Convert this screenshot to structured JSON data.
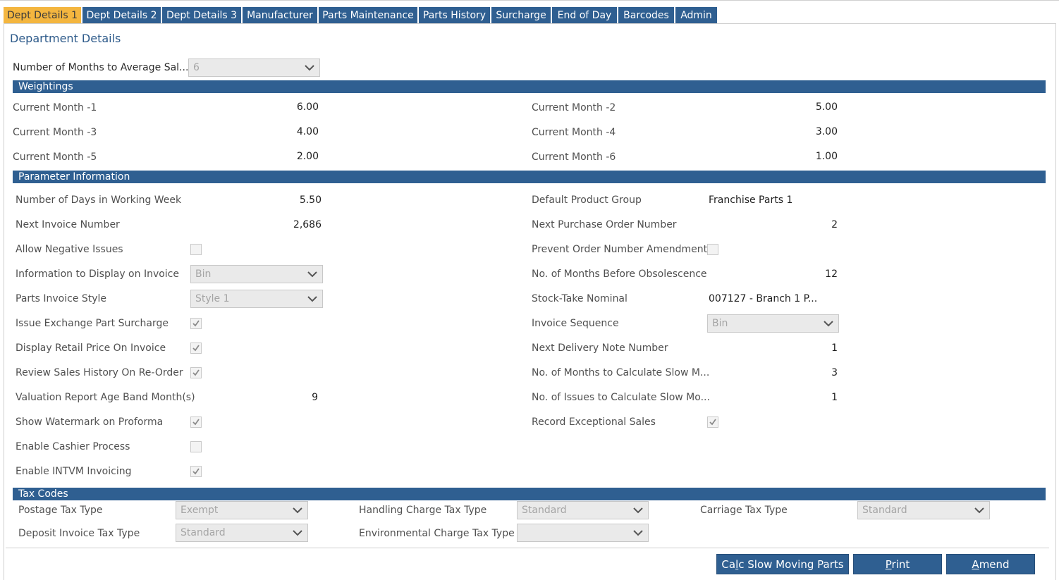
{
  "tabs": [
    {
      "label": "Dept Details 1"
    },
    {
      "label": "Dept Details 2"
    },
    {
      "label": "Dept Details 3"
    },
    {
      "label": "Manufacturer"
    },
    {
      "label": "Parts Maintenance"
    },
    {
      "label": "Parts History"
    },
    {
      "label": "Surcharge"
    },
    {
      "label": "End of Day"
    },
    {
      "label": "Barcodes"
    },
    {
      "label": "Admin"
    }
  ],
  "page_title": "Department Details",
  "months_to_average": {
    "label": "Number of Months to Average Sal...",
    "value": "6"
  },
  "weightings": {
    "header": "Weightings",
    "items": [
      {
        "label": "Current Month -1",
        "value": "6.00"
      },
      {
        "label": "Current Month -2",
        "value": "5.00"
      },
      {
        "label": "Current Month -3",
        "value": "4.00"
      },
      {
        "label": "Current Month -4",
        "value": "3.00"
      },
      {
        "label": "Current Month -5",
        "value": "2.00"
      },
      {
        "label": "Current Month -6",
        "value": "1.00"
      }
    ]
  },
  "parameters": {
    "header": "Parameter Information",
    "left": {
      "days_working_week": {
        "label": "Number of Days in Working Week",
        "value": "5.50"
      },
      "next_invoice": {
        "label": "Next Invoice Number",
        "value": "2,686"
      },
      "allow_negative": {
        "label": "Allow Negative Issues",
        "checked": false
      },
      "info_on_invoice": {
        "label": "Information to Display on Invoice",
        "value": "Bin"
      },
      "invoice_style": {
        "label": "Parts Invoice Style",
        "value": "Style 1"
      },
      "exchange_surcharge": {
        "label": "Issue Exchange Part Surcharge",
        "checked": true
      },
      "retail_price": {
        "label": "Display Retail Price On Invoice",
        "checked": true
      },
      "review_sales": {
        "label": "Review Sales History On Re-Order",
        "checked": true
      },
      "valuation_band": {
        "label": "Valuation Report Age Band Month(s)",
        "value": "9"
      },
      "watermark": {
        "label": "Show Watermark on Proforma",
        "checked": true
      },
      "cashier": {
        "label": "Enable Cashier Process",
        "checked": false
      },
      "intvm": {
        "label": "Enable INTVM Invoicing",
        "checked": true
      }
    },
    "right": {
      "product_group": {
        "label": "Default Product Group",
        "value": "Franchise Parts 1"
      },
      "next_po": {
        "label": "Next Purchase Order Number",
        "value": "2"
      },
      "prevent_amend": {
        "label": "Prevent Order Number Amendment",
        "checked": false
      },
      "obsolescence": {
        "label": "No. of Months Before Obsolescence",
        "value": "12"
      },
      "stocktake": {
        "label": "Stock-Take Nominal",
        "value": "007127 - Branch 1 P..."
      },
      "invoice_sequence": {
        "label": "Invoice Sequence",
        "value": "Bin"
      },
      "next_delivery": {
        "label": "Next Delivery Note Number",
        "value": "1"
      },
      "slow_months": {
        "label": "No. of Months to Calculate Slow M...",
        "value": "3"
      },
      "slow_issues": {
        "label": "No. of Issues to Calculate Slow Mo...",
        "value": "1"
      },
      "exceptional": {
        "label": "Record Exceptional Sales",
        "checked": true
      }
    }
  },
  "tax": {
    "header": "Tax Codes",
    "postage": {
      "label": "Postage Tax Type",
      "value": "Exempt"
    },
    "handling": {
      "label": "Handling Charge Tax Type",
      "value": "Standard"
    },
    "carriage": {
      "label": "Carriage Tax Type",
      "value": "Standard"
    },
    "deposit": {
      "label": "Deposit Invoice Tax Type",
      "value": "Standard"
    },
    "environmental": {
      "label": "Environmental Charge Tax Type",
      "value": ""
    }
  },
  "buttons": {
    "calc_prefix": "Ca",
    "calc_underline": "l",
    "calc_suffix": "c Slow Moving Parts",
    "print_underline": "P",
    "print_suffix": "rint",
    "amend_underline": "A",
    "amend_suffix": "mend"
  }
}
